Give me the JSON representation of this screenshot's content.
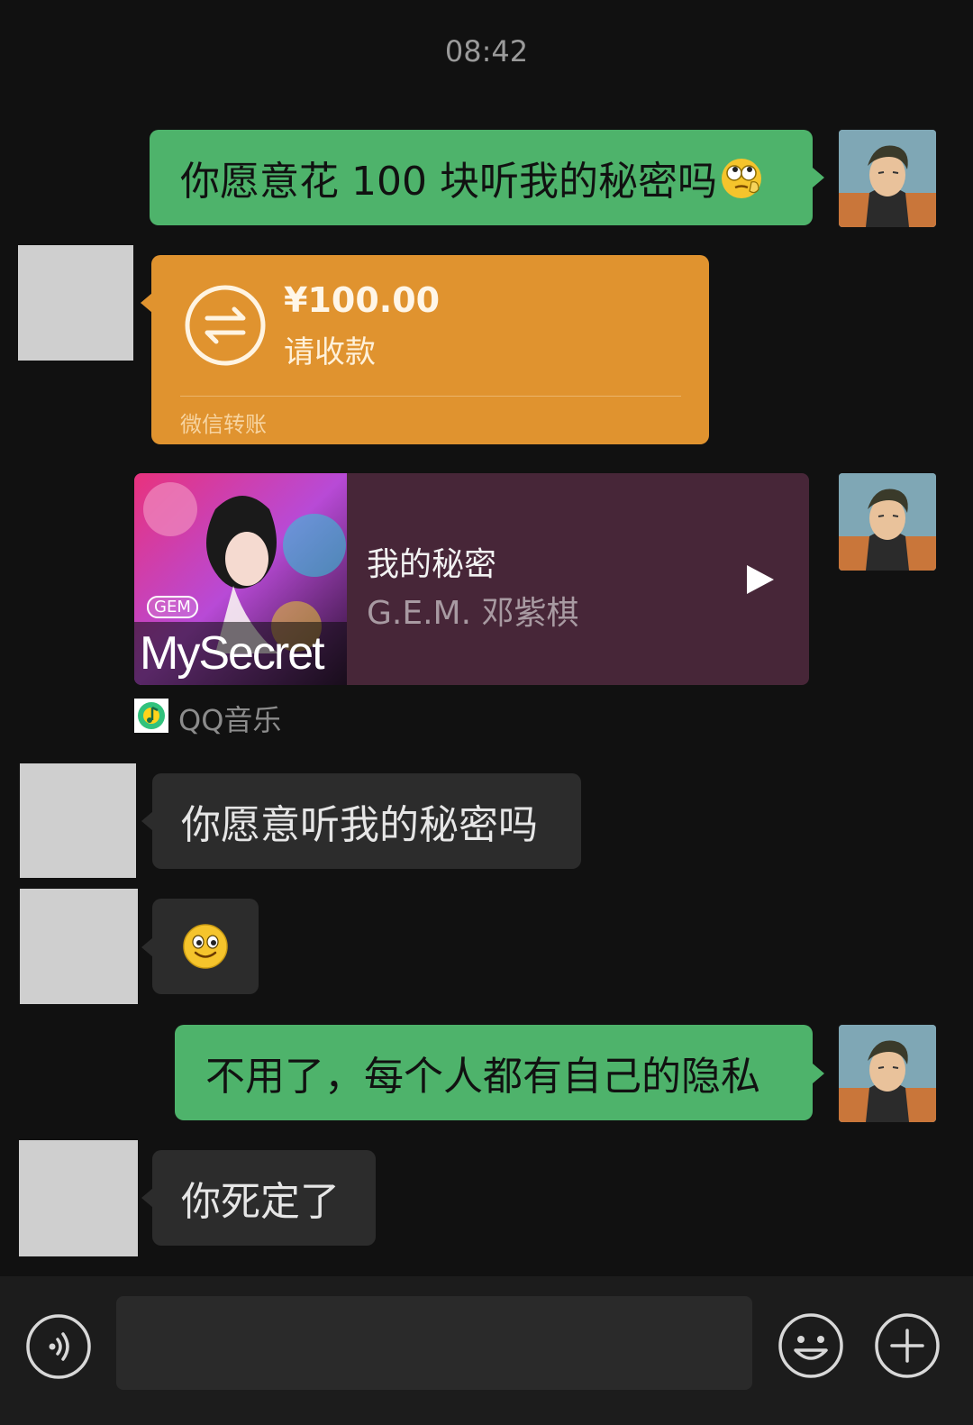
{
  "time": "08:42",
  "messages": {
    "m1_text": "你愿意花 100 块听我的秘密吗",
    "transfer_amount": "¥100.00",
    "transfer_status": "请收款",
    "transfer_footer": "微信转账",
    "music_title": "我的秘密",
    "music_artist": "G.E.M. 邓紫棋",
    "music_cover_brand": "GEM",
    "music_cover_text": "MySecret",
    "music_source": "QQ音乐",
    "m3_text": "你愿意听我的秘密吗",
    "m5_text": "不用了，每个人都有自己的隐私",
    "m6_text": "你死定了"
  },
  "input": {
    "value": ""
  },
  "icons": {
    "voice": "voice-icon",
    "emoji": "emoji-icon",
    "plus": "plus-icon",
    "transfer": "transfer-icon",
    "play": "play-icon",
    "qqmusic": "qq-music-logo",
    "smiley": "smiley-emoji",
    "eyeroll": "eyeroll-emoji"
  },
  "colors": {
    "background": "#111111",
    "sent_bubble": "#4eb36b",
    "received_bubble": "#2c2c2c",
    "transfer_card": "#e0932f",
    "music_card": "#472638"
  }
}
